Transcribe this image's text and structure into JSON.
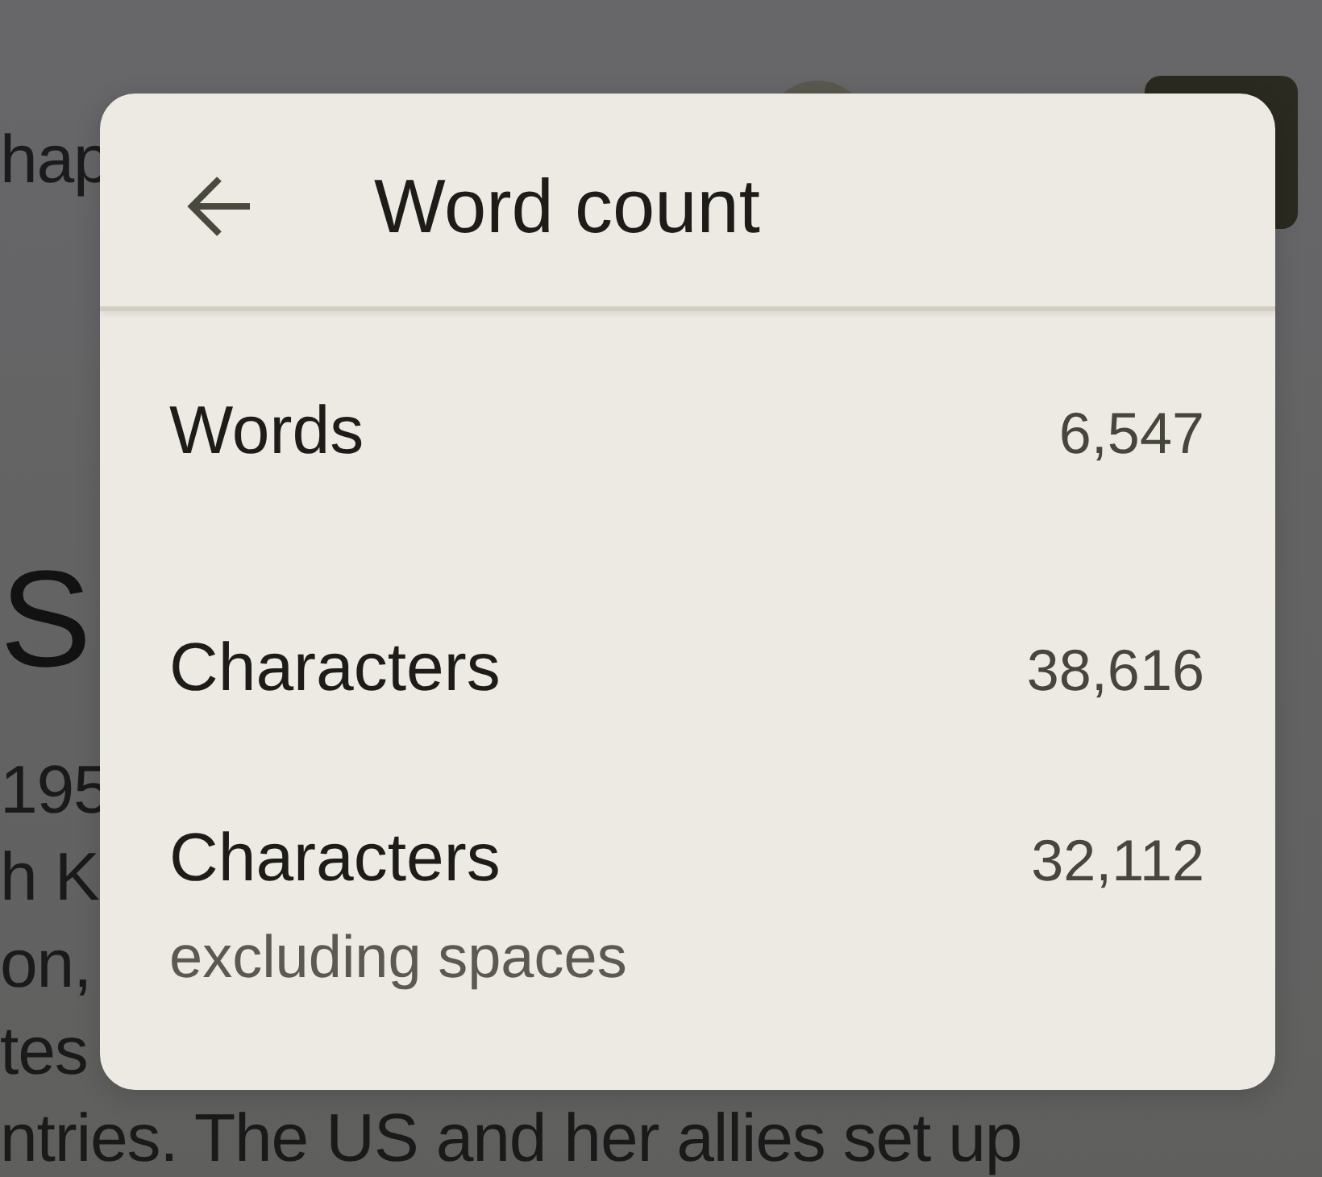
{
  "document": {
    "title": "hap",
    "heading": "S",
    "lines": [
      "195",
      "h K",
      "on,",
      "tes",
      "ntries. The US and her allies set up"
    ]
  },
  "dialog": {
    "title": "Word count",
    "stats": [
      {
        "label": "Words",
        "value": "6,547"
      },
      {
        "label": "Characters",
        "value": "38,616"
      },
      {
        "label": "Characters",
        "value": "32,112",
        "note": "excluding spaces"
      }
    ]
  }
}
